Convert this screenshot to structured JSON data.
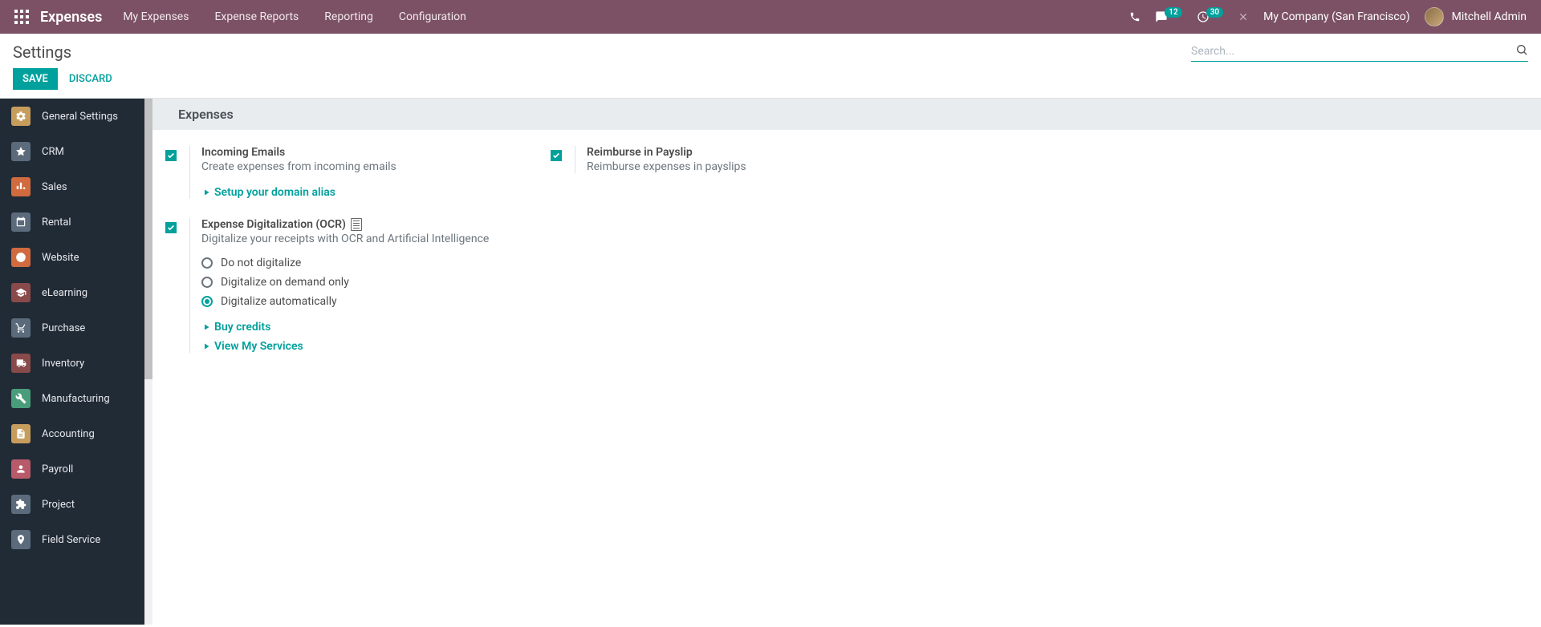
{
  "topnav": {
    "brand": "Expenses",
    "menu": [
      "My Expenses",
      "Expense Reports",
      "Reporting",
      "Configuration"
    ],
    "messages_badge": "12",
    "activities_badge": "30",
    "company": "My Company (San Francisco)",
    "user": "Mitchell Admin"
  },
  "control_panel": {
    "breadcrumb": "Settings",
    "search_placeholder": "Search...",
    "save_label": "Save",
    "discard_label": "Discard"
  },
  "sidebar": {
    "items": [
      {
        "label": "General Settings",
        "bg": "#c79d5e"
      },
      {
        "label": "CRM",
        "bg": "#5b6b7b"
      },
      {
        "label": "Sales",
        "bg": "#d16b3f"
      },
      {
        "label": "Rental",
        "bg": "#5b6b7b"
      },
      {
        "label": "Website",
        "bg": "#d16b3f"
      },
      {
        "label": "eLearning",
        "bg": "#8a4a4a"
      },
      {
        "label": "Purchase",
        "bg": "#5b6b7b"
      },
      {
        "label": "Inventory",
        "bg": "#8a4a4a"
      },
      {
        "label": "Manufacturing",
        "bg": "#4a9d7a"
      },
      {
        "label": "Accounting",
        "bg": "#c79d5e"
      },
      {
        "label": "Payroll",
        "bg": "#b85a6a"
      },
      {
        "label": "Project",
        "bg": "#5b6b7b"
      },
      {
        "label": "Field Service",
        "bg": "#5b6b7b"
      }
    ]
  },
  "content": {
    "section_title": "Expenses",
    "incoming_emails": {
      "title": "Incoming Emails",
      "desc": "Create expenses from incoming emails",
      "link": "Setup your domain alias",
      "checked": true
    },
    "reimburse": {
      "title": "Reimburse in Payslip",
      "desc": "Reimburse expenses in payslips",
      "checked": true
    },
    "ocr": {
      "title": "Expense Digitalization (OCR)",
      "desc": "Digitalize your receipts with OCR and Artificial Intelligence",
      "checked": true,
      "radios": [
        {
          "label": "Do not digitalize",
          "selected": false
        },
        {
          "label": "Digitalize on demand only",
          "selected": false
        },
        {
          "label": "Digitalize automatically",
          "selected": true
        }
      ],
      "link_credits": "Buy credits",
      "link_services": "View My Services"
    }
  }
}
